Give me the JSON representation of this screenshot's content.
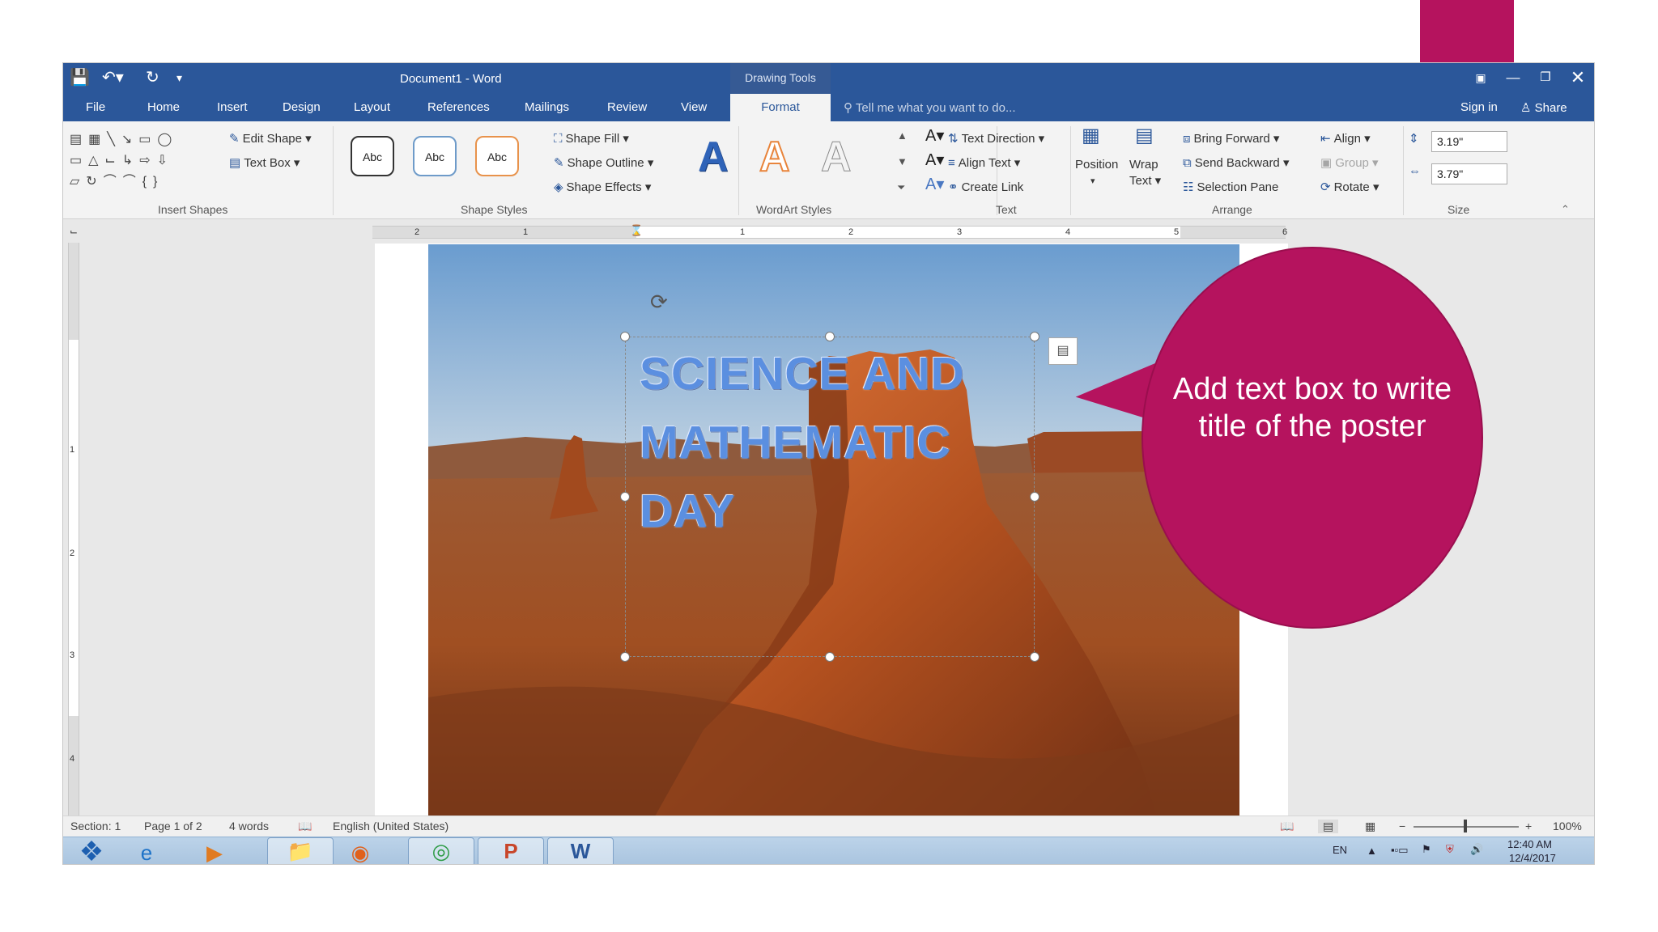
{
  "window": {
    "title": "Document1 - Word",
    "context_group": "Drawing Tools",
    "controls": [
      "restore-ribbon",
      "minimize",
      "restore",
      "close"
    ]
  },
  "qat": {
    "save_icon": "save-icon",
    "undo_icon": "undo-icon",
    "redo_icon": "redo-icon",
    "customize_icon": "customize-icon"
  },
  "tabs": [
    "File",
    "Home",
    "Insert",
    "Design",
    "Layout",
    "References",
    "Mailings",
    "Review",
    "View",
    "Format"
  ],
  "active_tab": "Format",
  "tell_me": "Tell me what you want to do...",
  "account": {
    "signin": "Sign in",
    "share": "Share"
  },
  "ribbon": {
    "insert_shapes": {
      "label": "Insert Shapes",
      "edit_shape": "Edit Shape",
      "text_box": "Text Box"
    },
    "shape_styles": {
      "label": "Shape Styles",
      "presets": [
        "Abc",
        "Abc",
        "Abc"
      ],
      "fill": "Shape Fill",
      "outline": "Shape Outline",
      "effects": "Shape Effects"
    },
    "wordart_styles": {
      "label": "WordArt Styles",
      "letters": [
        "A",
        "A",
        "A"
      ]
    },
    "text": {
      "label": "Text",
      "direction": "Text Direction",
      "align": "Align Text",
      "link": "Create Link"
    },
    "arrange": {
      "label": "Arrange",
      "position": "Position",
      "wrap_1": "Wrap",
      "wrap_2": "Text",
      "bring_forward": "Bring Forward",
      "send_backward": "Send Backward",
      "selection_pane": "Selection Pane",
      "align": "Align",
      "group": "Group",
      "rotate": "Rotate"
    },
    "size": {
      "label": "Size",
      "height": "3.19\"",
      "width": "3.79\""
    }
  },
  "ruler": {
    "h_numbers": [
      "2",
      "1",
      "1",
      "2",
      "3",
      "4",
      "5",
      "6"
    ],
    "v_numbers": [
      "1",
      "2",
      "3",
      "4"
    ]
  },
  "document": {
    "title_lines": [
      "SCIENCE AND",
      "MATHEMATIC",
      "DAY"
    ]
  },
  "status": {
    "section": "Section: 1",
    "page": "Page 1 of 2",
    "words": "4 words",
    "language": "English (United States)",
    "zoom": "100%"
  },
  "taskbar": {
    "apps": [
      "start-icon",
      "ie-icon",
      "media-player-icon",
      "explorer-icon",
      "firefox-icon",
      "chrome-icon",
      "powerpoint-icon",
      "word-icon"
    ],
    "lang": "EN",
    "time": "12:40 AM",
    "date": "12/4/2017"
  },
  "callout": {
    "text": "Add text box to write title of the poster",
    "color": "#b5135e"
  },
  "colors": {
    "word_blue": "#2b579a",
    "wordart_blue": "#5b8fe0"
  }
}
